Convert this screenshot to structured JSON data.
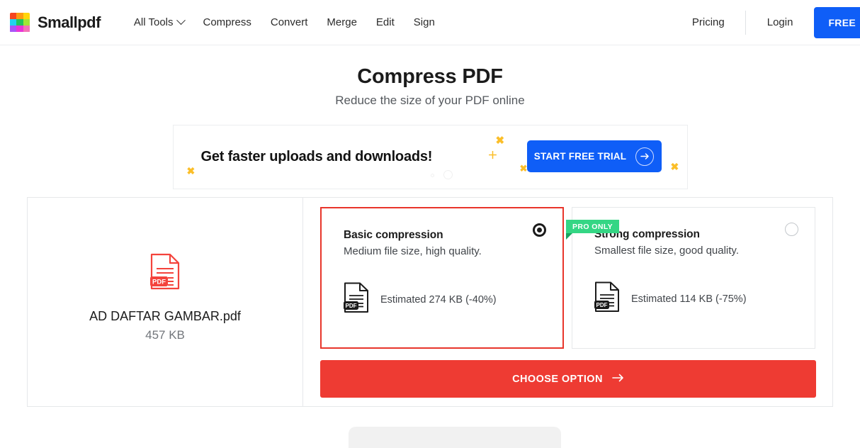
{
  "header": {
    "brand_name": "Smallpdf",
    "logo_colors": [
      "#f5451f",
      "#fd9a12",
      "#ffd60a",
      "#22d3ee",
      "#22c55e",
      "#a3e635",
      "#a855f7",
      "#e935d8",
      "#f472b6"
    ],
    "nav_items": [
      {
        "label": "All Tools",
        "has_chevron": true
      },
      {
        "label": "Compress",
        "has_chevron": false
      },
      {
        "label": "Convert",
        "has_chevron": false
      },
      {
        "label": "Merge",
        "has_chevron": false
      },
      {
        "label": "Edit",
        "has_chevron": false
      },
      {
        "label": "Sign",
        "has_chevron": false
      }
    ],
    "pricing_label": "Pricing",
    "login_label": "Login",
    "free_button_label": "FREE"
  },
  "page": {
    "title": "Compress PDF",
    "subtitle": "Reduce the size of your PDF online"
  },
  "promo": {
    "text": "Get faster uploads and downloads!",
    "button_label": "START FREE TRIAL",
    "button_color": "#0f5ef7",
    "decor_color": "#fbbe28",
    "decor_marks": [
      "✖",
      "✖",
      "✖",
      "＋",
      "✖"
    ]
  },
  "file": {
    "name": "AD DAFTAR GAMBAR.pdf",
    "size": "457 KB",
    "icon": "pdf-file-icon",
    "icon_color": "#f4433c"
  },
  "options": [
    {
      "id": "basic",
      "title": "Basic compression",
      "description": "Medium file size, high quality.",
      "estimate": "Estimated 274 KB (-40%)",
      "selected": true,
      "pro_only": false,
      "badge_label": ""
    },
    {
      "id": "strong",
      "title": "Strong compression",
      "description": "Smallest file size, good quality.",
      "estimate": "Estimated 114 KB (-75%)",
      "selected": false,
      "pro_only": true,
      "badge_label": "PRO ONLY"
    }
  ],
  "cta": {
    "label": "CHOOSE OPTION",
    "color": "#ee3b33"
  },
  "accents": {
    "selected_border": "#e8352b",
    "pro_badge": "#34d684"
  }
}
